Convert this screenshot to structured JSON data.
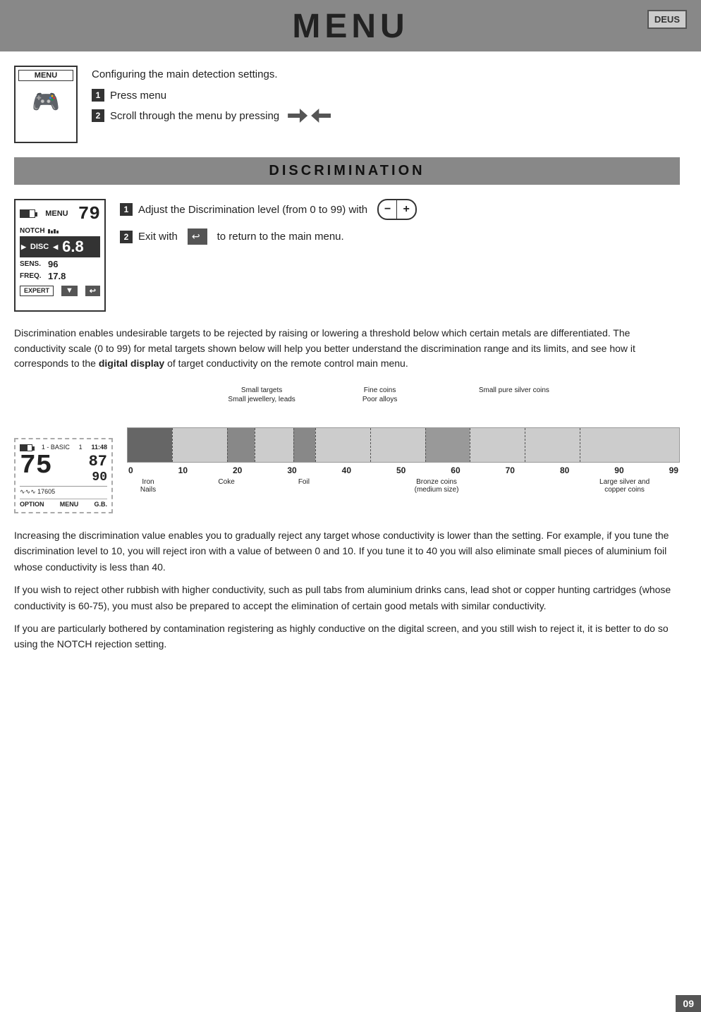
{
  "header": {
    "title": "MENU",
    "logo": "DEUS"
  },
  "intro": {
    "description": "Configuring the main detection settings.",
    "step1": "Press menu",
    "step2": "Scroll through the menu by pressing"
  },
  "discrimination_section": {
    "title": "DISCRIMINATION",
    "step1": "Adjust the Discrimination level (from 0 to 99) with",
    "step2": "Exit with",
    "step2_end": "to return to the main menu.",
    "device": {
      "menu_label": "MENU",
      "big_num": "79",
      "notch_label": "NOTCH",
      "disc_label": "DISC",
      "disc_value": "6.8",
      "sens_label": "SENS.",
      "sens_value": "96",
      "freq_label": "FREQ.",
      "freq_value": "17.8",
      "expert_label": "EXPERT"
    }
  },
  "discrimination_desc": "Discrimination enables undesirable targets to be rejected by raising or lowering a threshold below which certain metals are differentiated. The conductivity scale (0 to 99) for metal targets shown below will help you better understand the discrimination range and its limits, and see how it corresponds to the digital display of target conductivity on the remote control main menu.",
  "scale_device": {
    "header_left": "1 - BASIC",
    "header_mid": "1",
    "header_time": "11:48",
    "big_num": "75",
    "right_num": "87",
    "bottom_num": "90",
    "freq_val": "17605",
    "option": "OPTION",
    "menu": "MENU",
    "gb": "G.B."
  },
  "chart": {
    "labels_top": [
      {
        "text": "Small targets\nSmall jewellery, leads",
        "position": 22
      },
      {
        "text": "Fine coins\nPoor alloys",
        "position": 44
      },
      {
        "text": "Small pure silver coins",
        "position": 72
      }
    ],
    "labels_bottom": [
      {
        "text": "Iron\nNails",
        "position": 3
      },
      {
        "text": "Coke",
        "position": 20
      },
      {
        "text": "Foil",
        "position": 34
      },
      {
        "text": "Bronze coins\n(medium size)",
        "position": 59
      },
      {
        "text": "Large silver and\ncopper coins",
        "position": 88
      }
    ],
    "scale": [
      "0",
      "10",
      "20",
      "30",
      "40",
      "50",
      "60",
      "70",
      "80",
      "90",
      "99"
    ]
  },
  "long_description": {
    "para1": "Increasing the discrimination value enables you to gradually reject any target whose conductivity is lower than the setting. For example, if you tune the discrimination level to 10, you will reject iron with a value of between 0 and 10. If you tune it to 40 you will also eliminate small pieces of aluminium foil whose conductivity is less than 40.",
    "para2": "If you wish to reject other rubbish with higher conductivity, such as pull tabs from aluminium drinks cans, lead shot or copper hunting cartridges (whose conductivity is 60-75), you must also be prepared to accept the elimination of certain good metals with similar conductivity.",
    "para3": "If you are particularly bothered by contamination registering as highly conductive on the digital screen, and you still wish to reject it, it is better to do so using the NOTCH rejection setting."
  },
  "page_number": "09"
}
